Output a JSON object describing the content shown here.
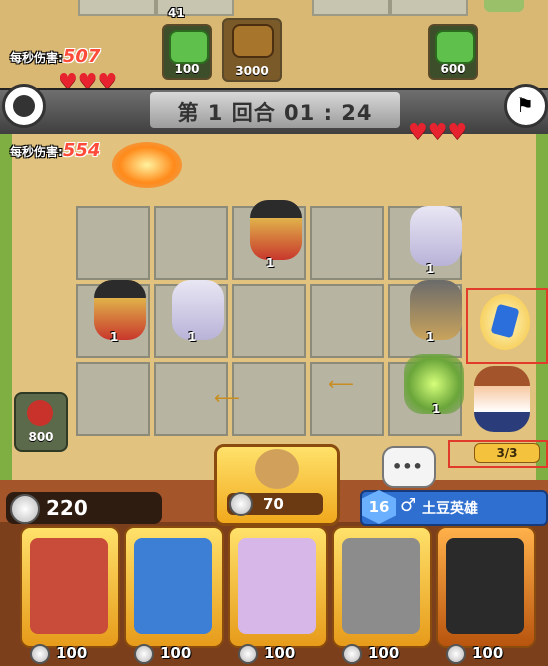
{
  "enemy": {
    "dps_label": "每秒伤害:",
    "dps_value": "507",
    "unit_top_count": "41",
    "units": [
      {
        "name": "green-slime-unit",
        "value": "100"
      },
      {
        "name": "boss-unit",
        "value": "3000"
      },
      {
        "name": "green-slime-unit-right",
        "value": "600"
      }
    ],
    "hearts": 3
  },
  "round": {
    "text": "第 1 回合 01 : 24"
  },
  "player": {
    "dps_label": "每秒伤害:",
    "dps_value": "554",
    "hearts": 3,
    "tower_value": "800",
    "board_levels": [
      "1",
      "1",
      "1",
      "1",
      "1",
      "1"
    ],
    "slots": "3/3"
  },
  "hero_pick": {
    "cost": "70"
  },
  "bottom": {
    "coins": "220",
    "hero_level": "16",
    "hero_name": "土豆英雄",
    "cards": [
      {
        "cost": "100",
        "color": "#c94b3a"
      },
      {
        "cost": "100",
        "color": "#3d7fd4"
      },
      {
        "cost": "100",
        "color": "#d7b6e8"
      },
      {
        "cost": "100",
        "color": "#8c8c8c"
      },
      {
        "cost": "100",
        "color": "#2a2a2a"
      }
    ]
  },
  "colors": {
    "accent_red": "#e13b2b",
    "panel_brown": "#7b3f1c",
    "gold": "#f4c23c"
  }
}
